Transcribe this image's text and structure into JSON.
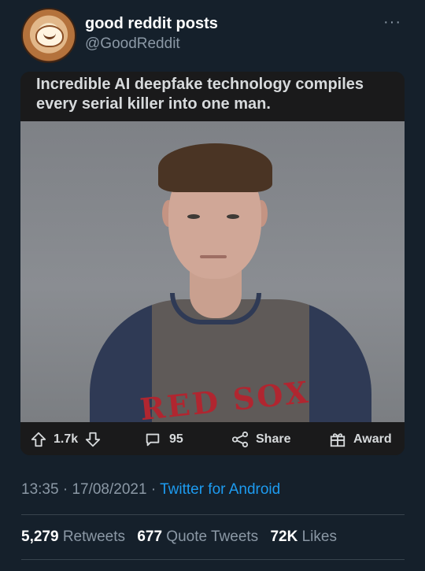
{
  "tweet": {
    "author_name": "good reddit posts",
    "handle": "@GoodReddit",
    "more_icon": "ellipsis-icon"
  },
  "reddit_card": {
    "title": "Incredible AI deepfake technology compiles every serial killer into one man.",
    "shirt_text": "RED SOX",
    "upvotes": "1.7k",
    "comments": "95",
    "share_label": "Share",
    "award_label": "Award"
  },
  "meta": {
    "time": "13:35",
    "date": "17/08/2021",
    "separator": "·",
    "app": "Twitter for Android"
  },
  "stats": {
    "retweets": "5,279",
    "retweets_label": "Retweets",
    "quote_tweets": "677",
    "quote_tweets_label": "Quote Tweets",
    "likes": "72K",
    "likes_label": "Likes"
  },
  "colors": {
    "background": "#15202b",
    "link": "#1d9bf0",
    "secondary_text": "#8b98a5"
  }
}
